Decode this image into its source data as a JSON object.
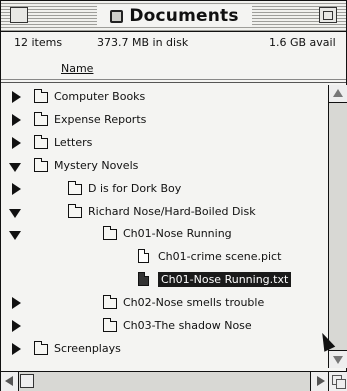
{
  "window": {
    "title": "Documents"
  },
  "info": {
    "items": "12 items",
    "disk": "373.7 MB in disk",
    "available": "1.6 GB avail"
  },
  "columns": {
    "name": "Name"
  },
  "rows": [
    {
      "label": "Computer Books",
      "kind": "folder",
      "disclosure": "closed",
      "level": 0
    },
    {
      "label": "Expense Reports",
      "kind": "folder",
      "disclosure": "closed",
      "level": 0
    },
    {
      "label": "Letters",
      "kind": "folder",
      "disclosure": "closed",
      "level": 0
    },
    {
      "label": "Mystery Novels",
      "kind": "folder",
      "disclosure": "open",
      "level": 0
    },
    {
      "label": "D is for Dork Boy",
      "kind": "folder",
      "disclosure": "closed",
      "level": 1
    },
    {
      "label": "Richard Nose/Hard-Boiled Disk",
      "kind": "folder",
      "disclosure": "open",
      "level": 1
    },
    {
      "label": "Ch01-Nose Running",
      "kind": "folder",
      "disclosure": "open",
      "level": 2
    },
    {
      "label": "Ch01-crime scene.pict",
      "kind": "document",
      "disclosure": "none",
      "level": 3
    },
    {
      "label": "Ch01-Nose Running.txt",
      "kind": "document",
      "disclosure": "none",
      "level": 3,
      "selected": true
    },
    {
      "label": "Ch02-Nose smells trouble",
      "kind": "folder",
      "disclosure": "closed",
      "level": 2
    },
    {
      "label": "Ch03-The shadow Nose",
      "kind": "folder",
      "disclosure": "closed",
      "level": 2
    },
    {
      "label": "Screenplays",
      "kind": "folder",
      "disclosure": "closed",
      "level": 0
    }
  ]
}
